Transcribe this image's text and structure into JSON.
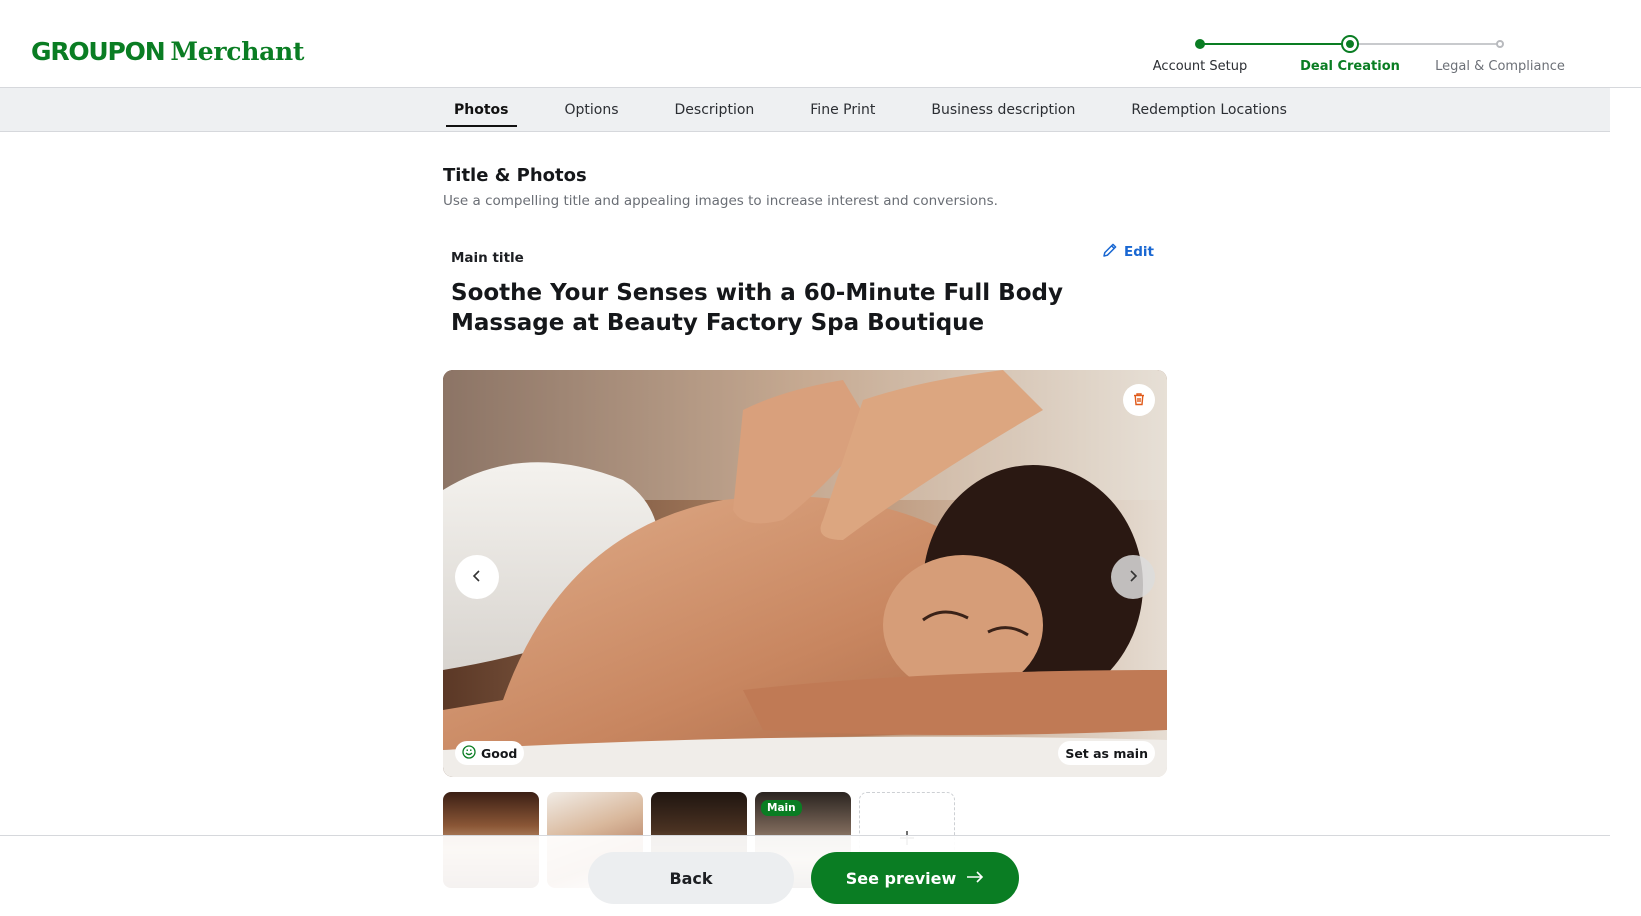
{
  "header": {
    "logo_brand": "GROUPON",
    "logo_suffix": "Merchant",
    "steps": [
      {
        "label": "Account Setup",
        "state": "complete"
      },
      {
        "label": "Deal Creation",
        "state": "current"
      },
      {
        "label": "Legal & Compliance",
        "state": "upcoming"
      }
    ]
  },
  "tabs": [
    {
      "label": "Photos",
      "active": true
    },
    {
      "label": "Options",
      "active": false
    },
    {
      "label": "Description",
      "active": false
    },
    {
      "label": "Fine Print",
      "active": false
    },
    {
      "label": "Business description",
      "active": false
    },
    {
      "label": "Redemption Locations",
      "active": false
    }
  ],
  "section": {
    "title": "Title & Photos",
    "subtitle": "Use a compelling title and appealing images to increase interest and conversions."
  },
  "main_title": {
    "label": "Main title",
    "edit_label": "Edit",
    "value": "Soothe Your Senses with a 60-Minute Full Body Massage at Beauty Factory Spa Boutique"
  },
  "hero": {
    "quality_label": "Good",
    "set_main_label": "Set as main"
  },
  "thumbnails": {
    "main_tag": "Main",
    "add_symbol": "+"
  },
  "footer": {
    "back_label": "Back",
    "preview_label": "See preview"
  },
  "colors": {
    "brand_green": "#0a7d23",
    "link_blue": "#1967d2",
    "trash_orange": "#e05a1a"
  },
  "icons": {
    "edit": "pencil-icon",
    "trash": "trash-icon",
    "prev": "chevron-left-icon",
    "next": "chevron-right-icon",
    "quality": "smiley-icon",
    "add": "plus-icon",
    "preview_arrow": "arrow-right-icon"
  }
}
